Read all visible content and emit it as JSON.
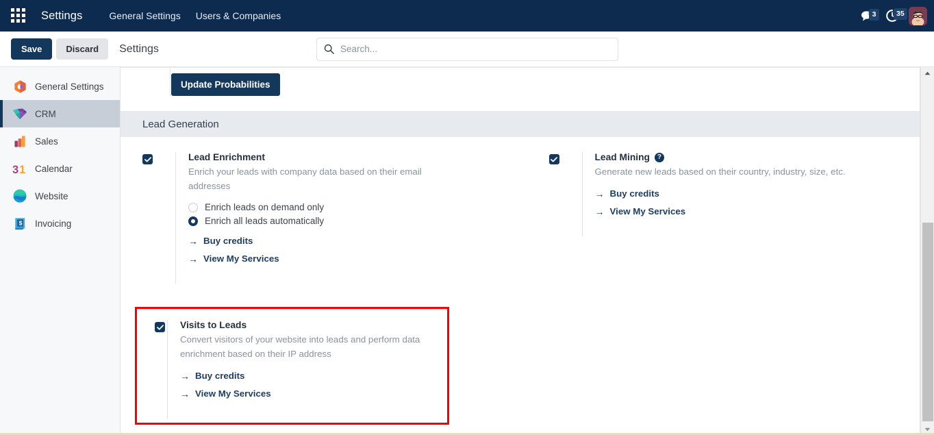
{
  "navbar": {
    "apps_icon": "apps-grid-icon",
    "brand": "Settings",
    "links": [
      {
        "label": "General Settings"
      },
      {
        "label": "Users & Companies"
      }
    ],
    "messages_icon": "messages-icon",
    "messages_count": "3",
    "activities_icon": "clock-activities-icon",
    "activities_count": "35",
    "avatar_icon": "user-avatar"
  },
  "control_panel": {
    "save_label": "Save",
    "discard_label": "Discard",
    "title": "Settings",
    "search_icon": "search-icon",
    "search_placeholder": "Search...",
    "search_value": ""
  },
  "sidebar": {
    "items": [
      {
        "label": "General Settings",
        "icon": "general-settings-icon",
        "active": false
      },
      {
        "label": "CRM",
        "icon": "crm-icon",
        "active": true
      },
      {
        "label": "Sales",
        "icon": "sales-icon",
        "active": false
      },
      {
        "label": "Calendar",
        "icon": "calendar-icon",
        "active": false
      },
      {
        "label": "Website",
        "icon": "website-icon",
        "active": false
      },
      {
        "label": "Invoicing",
        "icon": "invoicing-icon",
        "active": false
      }
    ]
  },
  "main": {
    "update_probabilities_label": "Update Probabilities",
    "section_title": "Lead Generation",
    "lead_enrichment": {
      "title": "Lead Enrichment",
      "checked": true,
      "description": "Enrich your leads with company data based on their email addresses",
      "radios": [
        {
          "label": "Enrich leads on demand only",
          "selected": false
        },
        {
          "label": "Enrich all leads automatically",
          "selected": true
        }
      ],
      "links": [
        {
          "label": "Buy credits",
          "arrow": "→"
        },
        {
          "label": "View My Services",
          "arrow": "→"
        }
      ]
    },
    "lead_mining": {
      "title": "Lead Mining",
      "checked": true,
      "help_icon": "help-question-icon",
      "help_glyph": "?",
      "description": "Generate new leads based on their country, industry, size, etc.",
      "links": [
        {
          "label": "Buy credits",
          "arrow": "→"
        },
        {
          "label": "View My Services",
          "arrow": "→"
        }
      ]
    },
    "visits_to_leads": {
      "title": "Visits to Leads",
      "checked": true,
      "description": "Convert visitors of your website into leads and perform data enrichment based on their IP address",
      "links": [
        {
          "label": "Buy credits",
          "arrow": "→"
        },
        {
          "label": "View My Services",
          "arrow": "→"
        }
      ],
      "highlight_color": "#fa0000"
    }
  },
  "scrollbar": {
    "up_icon": "scroll-up-arrow-icon",
    "down_icon": "scroll-down-arrow-icon"
  },
  "colors": {
    "navbar_bg": "#0d2b4e",
    "primary": "#14385c",
    "section_bg": "#e7eaee",
    "sidebar_bg": "#f7f8fa",
    "sidebar_active_bg": "#c8ced7",
    "muted_text": "#8a939d",
    "highlight": "#fa0000"
  }
}
